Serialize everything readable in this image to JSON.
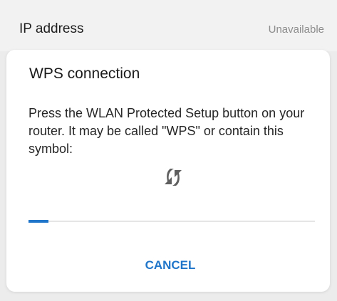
{
  "settings": {
    "ip_label": "IP address",
    "ip_value": "Unavailable"
  },
  "dialog": {
    "title": "WPS connection",
    "message": "Press the WLAN Protected Setup button on your router. It may be called \"WPS\" or contain this symbol:",
    "icon": "wps-sync-icon",
    "progress": 0.07,
    "cancel_label": "CANCEL"
  },
  "colors": {
    "accent": "#1f75c9",
    "text_primary": "#1a1a1a",
    "text_secondary": "#8c8c8c",
    "icon_gray": "#5f5f5f",
    "background": "#ececec",
    "dialog_background": "#ffffff"
  }
}
